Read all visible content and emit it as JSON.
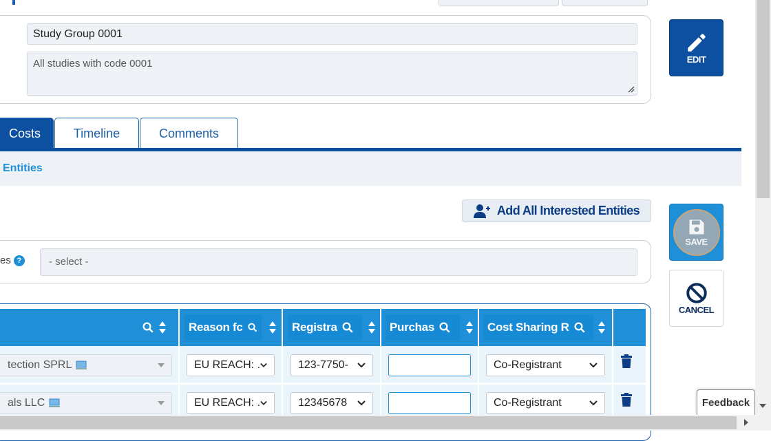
{
  "header": {
    "name_value": "Study Group 0001",
    "description_value": "All studies with code 0001"
  },
  "actions": {
    "edit_label": "EDIT",
    "save_label": "SAVE",
    "cancel_label": "CANCEL"
  },
  "tabs": [
    {
      "label": "Costs",
      "active": true
    },
    {
      "label": "Timeline",
      "active": false
    },
    {
      "label": "Comments",
      "active": false
    }
  ],
  "subbar": {
    "link_label": "Entities"
  },
  "add_all_button": {
    "label": "Add All Interested Entities",
    "icon": "user-plus-icon"
  },
  "select_section": {
    "label_partial": "es",
    "help_icon": "?",
    "placeholder": "- select -"
  },
  "table": {
    "columns": [
      {
        "label": ""
      },
      {
        "label": "Reason fc"
      },
      {
        "label": "Registra"
      },
      {
        "label": "Purchas"
      },
      {
        "label": "Cost Sharing R"
      }
    ],
    "rows": [
      {
        "entity": "tection SPRL",
        "reason": "EU REACH: .",
        "registration": "123-7750-",
        "purchase": "",
        "cost_sharing": "Co-Registrant"
      },
      {
        "entity": "als LLC",
        "reason": "EU REACH: .",
        "registration": "12345678",
        "purchase": "",
        "cost_sharing": "Co-Registrant"
      }
    ]
  },
  "feedback": {
    "label": "Feedback"
  },
  "colors": {
    "primary": "#0d4fa0",
    "accent": "#1f90d8",
    "panel": "#eef2f6"
  }
}
